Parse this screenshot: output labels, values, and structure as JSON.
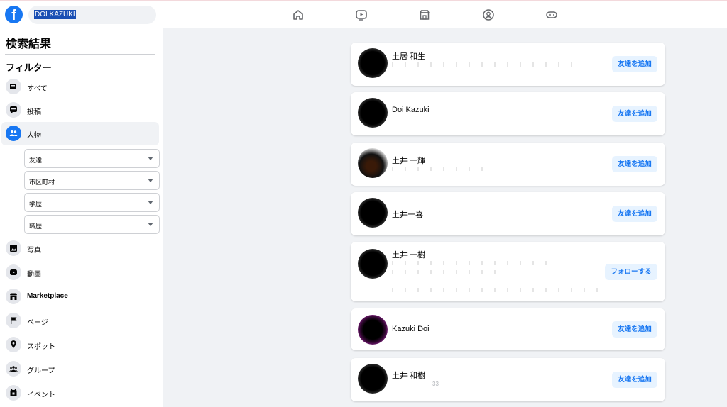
{
  "topbar": {
    "logo_letter": "f",
    "search_value": "DOI KAZUKI",
    "nav_icons": [
      "home-icon",
      "watch-icon",
      "marketplace-icon",
      "groups-icon",
      "gaming-icon"
    ]
  },
  "sidebar": {
    "title": "検索結果",
    "filter_title": "フィルター",
    "items": [
      {
        "label": "すべて",
        "icon": "all-icon"
      },
      {
        "label": "投稿",
        "icon": "posts-icon"
      },
      {
        "label": "人物",
        "icon": "people-icon"
      },
      {
        "label": "写真",
        "icon": "photos-icon"
      },
      {
        "label": "動画",
        "icon": "videos-icon"
      },
      {
        "label": "Marketplace",
        "icon": "marketplace-icon"
      },
      {
        "label": "ページ",
        "icon": "pages-icon"
      },
      {
        "label": "スポット",
        "icon": "places-icon"
      },
      {
        "label": "グループ",
        "icon": "groups-icon"
      },
      {
        "label": "イベント",
        "icon": "events-icon"
      }
    ],
    "people_filters": [
      "友達",
      "市区町村",
      "学歴",
      "職歴"
    ]
  },
  "results": [
    {
      "name": "土居 和生",
      "button": "友達を追加"
    },
    {
      "name": "Doi Kazuki",
      "button": "友達を追加"
    },
    {
      "name": "土井 一輝",
      "button": "友達を追加"
    },
    {
      "name": "土井一喜",
      "button": "友達を追加"
    },
    {
      "name": "土井 一樹",
      "button": "フォローする"
    },
    {
      "name": "Kazuki Doi",
      "button": "友達を追加"
    },
    {
      "name": "土井 和樹",
      "button": "友達を追加",
      "sub": "33"
    }
  ],
  "colors": {
    "accent": "#1877f2",
    "button_bg": "#e7f3ff",
    "page_bg": "#f0f2f5"
  }
}
